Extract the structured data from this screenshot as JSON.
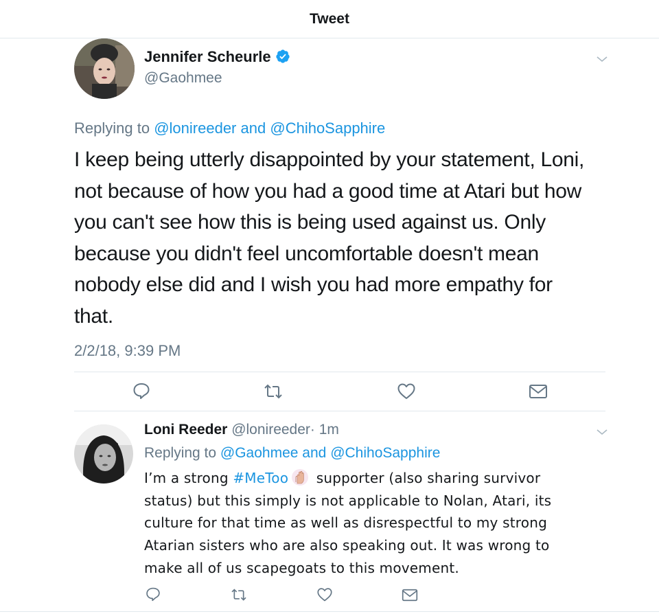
{
  "header": {
    "title": "Tweet"
  },
  "main_tweet": {
    "author_name": "Jennifer Scheurle",
    "author_handle": "@Gaohmee",
    "replying_prefix": "Replying to",
    "replying_user_1": "@lonireeder",
    "replying_and": "and",
    "replying_user_2": "@ChihoSapphire",
    "body_lines": [
      "I keep being utterly disappointed by your statement, Loni,",
      "not because of how you had a good time at Atari but how",
      "you can't see how this is being used against us. Only",
      "because you didn't feel uncomfortable doesn't mean",
      "nobody else did and I wish you had more empathy for",
      "that."
    ],
    "timestamp": "2/2/18, 9:39 PM",
    "actions": [
      "reply-icon",
      "retweet-icon",
      "like-icon",
      "message-icon"
    ]
  },
  "reply_tweet": {
    "author_name": "Loni Reeder",
    "author_handle": "@lonireeder",
    "time_ago": "· 1m",
    "replying_prefix": "Replying to",
    "replying_user_1": "@Gaohmee",
    "replying_and": "and",
    "replying_user_2": "@ChihoSapphire",
    "body_line_1_start": "I’m a strong",
    "hashtag": "#MeToo",
    "emoji": "raised-hand-emoji",
    "body_line_1_end": "supporter (also sharing survivor",
    "body_lines": [
      "status) but this simply is not applicable to Nolan, Atari, its",
      "culture for that time as well as disrespectful to my strong",
      "Atarian sisters who are also speaking out. It was wrong to",
      "make all of us scapegoats to this movement."
    ],
    "actions": [
      "reply-icon",
      "retweet-icon",
      "like-icon",
      "message-icon"
    ]
  },
  "colors": {
    "link": "#1b95e0",
    "secondary_text": "#657786",
    "primary_text": "#14171a",
    "divider": "#e1e8ed",
    "icon": "#657786"
  }
}
